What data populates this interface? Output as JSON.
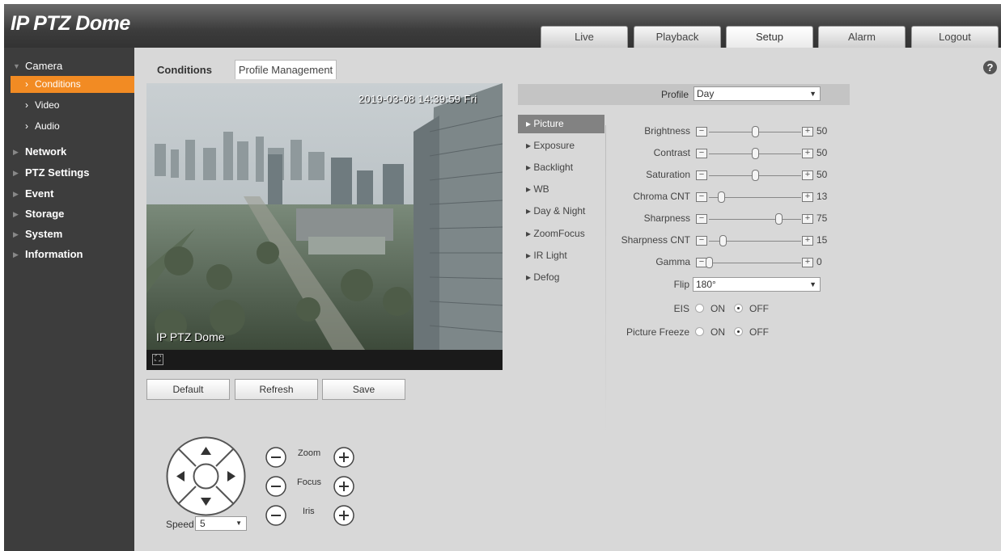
{
  "header": {
    "title": "IP PTZ Dome"
  },
  "nav": {
    "live": "Live",
    "playback": "Playback",
    "setup": "Setup",
    "alarm": "Alarm",
    "logout": "Logout"
  },
  "sidebar": {
    "camera": "Camera",
    "conditions": "Conditions",
    "video": "Video",
    "audio": "Audio",
    "network": "Network",
    "ptz": "PTZ Settings",
    "event": "Event",
    "storage": "Storage",
    "system": "System",
    "information": "Information"
  },
  "tabs": {
    "conditions": "Conditions",
    "profile": "Profile Management"
  },
  "video": {
    "osd_time": "2019-03-08 14:39:59 Fri",
    "osd_name": "IP PTZ Dome"
  },
  "buttons": {
    "default": "Default",
    "refresh": "Refresh",
    "save": "Save"
  },
  "ptz": {
    "zoom": "Zoom",
    "focus": "Focus",
    "iris": "Iris",
    "speed_label": "Speed",
    "speed_value": "5"
  },
  "profile": {
    "label": "Profile",
    "value": "Day"
  },
  "submenu": {
    "picture": "Picture",
    "exposure": "Exposure",
    "backlight": "Backlight",
    "wb": "WB",
    "daynight": "Day & Night",
    "zoomfocus": "ZoomFocus",
    "irlight": "IR Light",
    "defog": "Defog"
  },
  "settings": {
    "brightness": {
      "label": "Brightness",
      "value": 50
    },
    "contrast": {
      "label": "Contrast",
      "value": 50
    },
    "saturation": {
      "label": "Saturation",
      "value": 50
    },
    "chroma": {
      "label": "Chroma CNT",
      "value": 13
    },
    "sharpness": {
      "label": "Sharpness",
      "value": 75
    },
    "sharpness_cnt": {
      "label": "Sharpness CNT",
      "value": 15
    },
    "gamma": {
      "label": "Gamma",
      "value": 0
    },
    "flip": {
      "label": "Flip",
      "value": "180°"
    },
    "eis": {
      "label": "EIS",
      "on": "ON",
      "off": "OFF",
      "selected": "OFF"
    },
    "freeze": {
      "label": "Picture Freeze",
      "on": "ON",
      "off": "OFF",
      "selected": "OFF"
    }
  }
}
